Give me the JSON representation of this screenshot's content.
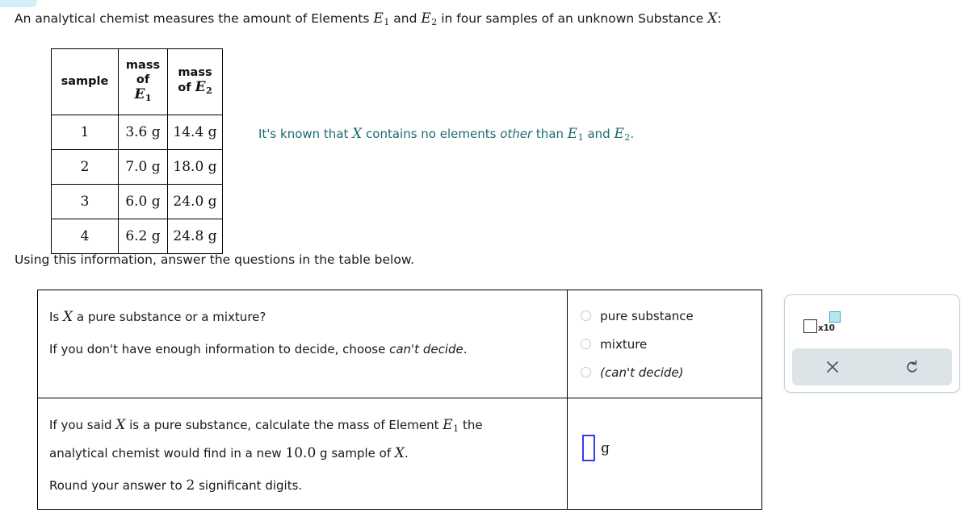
{
  "decor": {
    "tab_name": "cyan-tab",
    "tab_color": "#d3eff5"
  },
  "intro": {
    "part1": "An analytical chemist measures the amount of Elements ",
    "elem1": "E",
    "elem1_sub": "1",
    "part2": " and ",
    "elem2": "E",
    "elem2_sub": "2",
    "part3": " in four samples of an unknown Substance ",
    "substance": "X",
    "part4": ":"
  },
  "data_table": {
    "headers": {
      "sample": "sample",
      "mass_of": "mass",
      "of": "of",
      "e1": "E",
      "e1_sub": "1",
      "mass2": "mass",
      "of2": "of ",
      "e2": "E",
      "e2_sub": "2"
    },
    "rows": [
      {
        "sample": "1",
        "mass_e1": "3.6 g",
        "mass_e2": "14.4 g"
      },
      {
        "sample": "2",
        "mass_e1": "7.0 g",
        "mass_e2": "18.0 g"
      },
      {
        "sample": "3",
        "mass_e1": "6.0 g",
        "mass_e2": "24.0 g"
      },
      {
        "sample": "4",
        "mass_e1": "6.2 g",
        "mass_e2": "24.8 g"
      }
    ]
  },
  "note": {
    "part1": "It's known that ",
    "substance": "X",
    "part2": " contains no elements ",
    "emphasis": "other",
    "part3": " than ",
    "elem1": "E",
    "elem1_sub": "1",
    "part4": " and ",
    "elem2": "E",
    "elem2_sub": "2",
    "part5": ".",
    "color": "#1d6a72"
  },
  "using_line": "Using this information, answer the questions in the table below.",
  "questions": [
    {
      "prompt_line1_a": "Is ",
      "prompt_line1_var": "X",
      "prompt_line1_b": " a pure substance or a mixture?",
      "prompt_line2_a": "If you don't have enough information to decide, choose ",
      "prompt_line2_em": "can't decide",
      "prompt_line2_b": ".",
      "options": [
        {
          "label": "pure substance",
          "italic": false,
          "selected": false
        },
        {
          "label": "mixture",
          "italic": false,
          "selected": false
        },
        {
          "label": "(can't decide)",
          "italic": true,
          "selected": false
        }
      ]
    },
    {
      "prompt_line1_a": "If you said ",
      "prompt_line1_var": "X",
      "prompt_line1_b": " is a pure substance, calculate the mass of Element ",
      "prompt_line1_elem": "E",
      "prompt_line1_elem_sub": "1",
      "prompt_line1_c": " the",
      "prompt_line2_a": "analytical chemist would find in a new ",
      "prompt_line2_num": "10.0",
      "prompt_line2_b": " g sample of ",
      "prompt_line2_var": "X",
      "prompt_line2_c": ".",
      "prompt_line3_a": "Round your answer to ",
      "prompt_line3_num": "2",
      "prompt_line3_b": " significant digits.",
      "answer_value": "",
      "answer_unit": "g",
      "answer_border_color": "#2f3df0"
    }
  ],
  "tool_panel": {
    "sci_notation_label": "x10",
    "clear_label": "×",
    "undo_label": "↺",
    "footer_color": "#dde4e8",
    "border_color": "#bfd3da",
    "exponent_fill": "#b8e6f0"
  }
}
